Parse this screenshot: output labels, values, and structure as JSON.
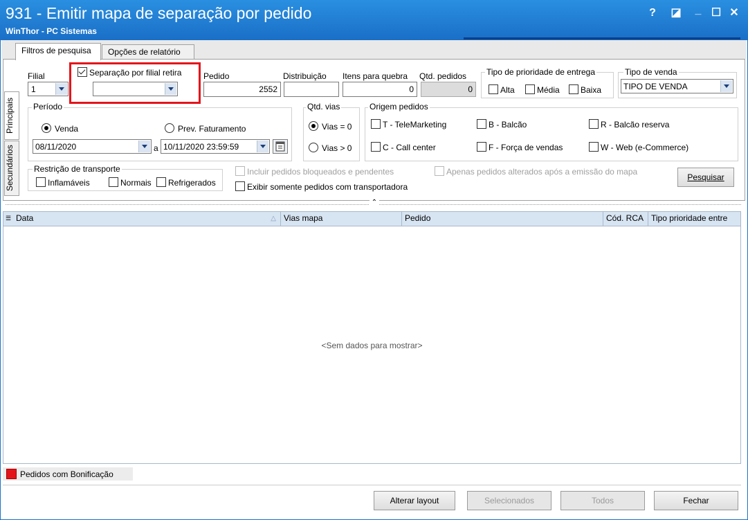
{
  "window": {
    "title": "931 - Emitir mapa de separação por pedido",
    "subtitle": "WinThor - PC Sistemas",
    "controls": {
      "help": "?",
      "restore": "◪",
      "minimize": "_",
      "maximize": "☐",
      "close": "✕"
    }
  },
  "tabs": [
    "Filtros de pesquisa",
    "Opções de relatório"
  ],
  "side_tabs": [
    "Principais",
    "Secundários"
  ],
  "filters": {
    "filial_label": "Filial",
    "filial_value": "1",
    "separacao_label": "Separação por filial retira",
    "separacao_value": "",
    "pedido_label": "Pedido",
    "pedido_value": "2552",
    "distribuicao_label": "Distribuição",
    "distribuicao_value": "",
    "itens_label": "Itens para quebra",
    "itens_value": "0",
    "qtd_pedidos_label": "Qtd. pedidos",
    "qtd_pedidos_value": "0",
    "prioridade_title": "Tipo de prioridade de  entrega",
    "prioridade_options": [
      "Alta",
      "Média",
      "Baixa"
    ],
    "tipo_venda_title": "Tipo de venda",
    "tipo_venda_value": "TIPO DE VENDA",
    "periodo_title": "Período",
    "periodo_venda": "Venda",
    "periodo_prev": "Prev. Faturamento",
    "data_inicio": "08/11/2020",
    "data_sep": "a",
    "data_fim": "10/11/2020 23:59:59",
    "qtd_vias_title": "Qtd. vias",
    "vias_eq": "Vias = 0",
    "vias_gt": "Vias > 0",
    "origem_title": "Origem pedidos",
    "origem_options": [
      "T - TeleMarketing",
      "B - Balcão",
      "R - Balcão reserva",
      "C - Call center",
      "F - Força de vendas",
      "W - Web (e-Commerce)"
    ],
    "restricao_title": "Restrição de transporte",
    "restricao_options": [
      "Inflamáveis",
      "Normais",
      "Refrigerados"
    ],
    "incluir_bloqueados": "Incluir pedidos bloqueados e pendentes",
    "apenas_alterados": "Apenas pedidos alterados após a emissão do mapa",
    "exibir_transportadora": "Exibir somente pedidos com transportadora",
    "pesquisar": "Pesquisar"
  },
  "grid": {
    "columns": [
      "Data",
      "Vias mapa",
      "Pedido",
      "Cód. RCA",
      "Tipo prioridade entre"
    ],
    "empty_text": "<Sem dados para mostrar>"
  },
  "legend": {
    "label": "Pedidos com Bonificação",
    "color": "#e4141b"
  },
  "footer": {
    "alterar_layout": "Alterar layout",
    "selecionados": "Selecionados",
    "todos": "Todos",
    "fechar": "Fechar"
  }
}
